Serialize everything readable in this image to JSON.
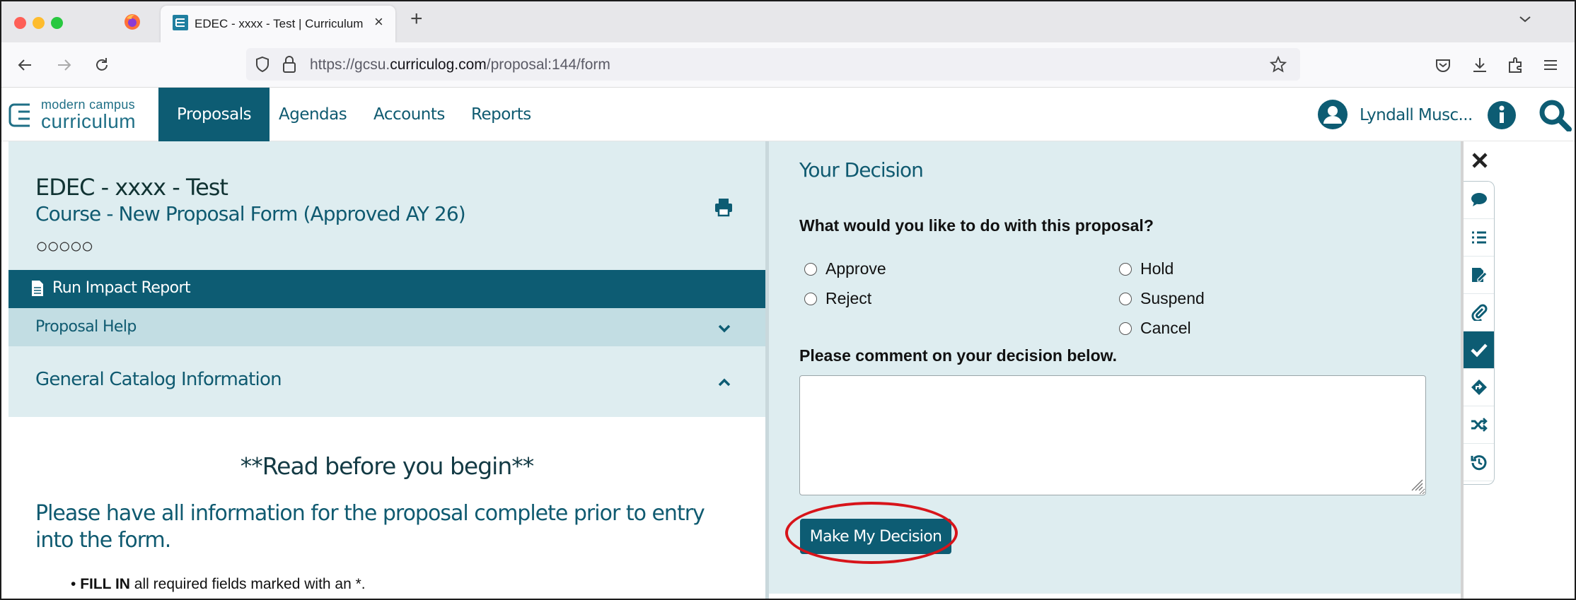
{
  "browser": {
    "tab_title": "EDEC - xxxx - Test | Curriculum",
    "tab_close": "×",
    "new_tab": "+",
    "url_prefix": "https://gcsu.",
    "url_domain": "curriculog.com",
    "url_path": "/proposal:144/form"
  },
  "header": {
    "logo_line1": "modern campus",
    "logo_line2": "curriculum",
    "nav": [
      "Proposals",
      "Agendas",
      "Accounts",
      "Reports"
    ],
    "active_nav": "Proposals",
    "user_name": "Lyndall Musc..."
  },
  "proposal": {
    "title": "EDEC - xxxx - Test",
    "form_name": "Course - New Proposal Form (Approved AY 26)",
    "step_circles": "○○○○○",
    "run_impact_report": "Run Impact Report",
    "proposal_help": "Proposal Help",
    "section_title": "General Catalog Information",
    "read_before": "**Read before you begin**",
    "please_have": "Please have all information for the proposal complete prior to entry into the form.",
    "bullet_bold": "FILL IN",
    "bullet_rest": " all required fields marked with an *."
  },
  "decision": {
    "title": "Your Decision",
    "question": "What would you like to do with this proposal?",
    "options_left": [
      "Approve",
      "Reject"
    ],
    "options_right": [
      "Hold",
      "Suspend",
      "Cancel"
    ],
    "comment_label": "Please comment on your decision below.",
    "comment_value": "",
    "submit_label": "Make My Decision"
  },
  "tools": [
    "close-icon",
    "comment-icon",
    "list-icon",
    "edit-form-icon",
    "attachment-icon",
    "decision-check-icon",
    "route-icon",
    "shuffle-icon",
    "history-icon"
  ],
  "colors": {
    "brand_teal": "#0d5c73",
    "panel_bg": "#deedf0",
    "highlight_red": "#d7141a"
  }
}
